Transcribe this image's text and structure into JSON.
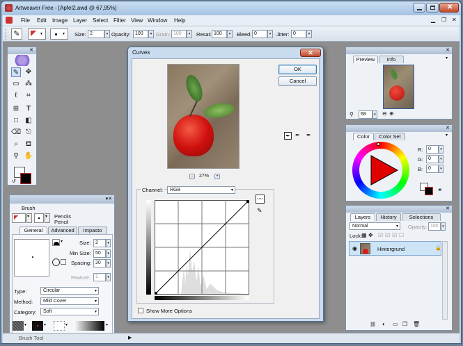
{
  "window": {
    "title": "Artweaver Free - [Apfel2.awd @ 67,95%]"
  },
  "menu": [
    "File",
    "Edit",
    "Image",
    "Layer",
    "Select",
    "Filter",
    "View",
    "Window",
    "Help"
  ],
  "toolbar": {
    "size_label": "Size:",
    "size_value": "2",
    "opacity_label": "Opacity:",
    "opacity_value": "100",
    "grain_label": "Grain:",
    "grain_value": "100",
    "resat_label": "Resat:",
    "resat_value": "100",
    "bleed_label": "Bleed:",
    "bleed_value": "0",
    "jitter_label": "Jitter:",
    "jitter_value": "0"
  },
  "brush_panel": {
    "title": "Brush",
    "category_name": "Pencils",
    "variant_name": "Pencil",
    "tabs": [
      "General",
      "Advanced",
      "Impasto"
    ],
    "size_label": "Size:",
    "size_value": "2",
    "min_size_label": "Min Size:",
    "min_size_value": "50",
    "spacing_label": "Spacing:",
    "spacing_value": "20",
    "feature_label": "Feature:",
    "feature_value": "1",
    "type_label": "Type:",
    "type_value": "Circular",
    "method_label": "Method:",
    "method_value": "Mild Cover",
    "category_label": "Category:",
    "category_value": "Soft"
  },
  "curves_dialog": {
    "title": "Curves",
    "ok_label": "OK",
    "cancel_label": "Cancel",
    "zoom_value": "27%",
    "channel_label": "Channel:",
    "channel_value": "RGB",
    "show_more_label": "Show More Options"
  },
  "preview_panel": {
    "tabs": [
      "Preview",
      "Info"
    ],
    "zoom_value": "68"
  },
  "color_panel": {
    "tabs": [
      "Color",
      "Color Set"
    ],
    "r_label": "R:",
    "r_value": "0",
    "g_label": "G:",
    "g_value": "0",
    "b_label": "B:",
    "b_value": "0"
  },
  "layers_panel": {
    "tabs": [
      "Layers",
      "History",
      "Selections"
    ],
    "blend_mode": "Normal",
    "opacity_label": "Opacity:",
    "opacity_value": "100",
    "lock_label": "Lock:",
    "layer_name": "Hintergrund"
  },
  "status": {
    "text": "Brush Tool"
  },
  "colors": {
    "accent": "#2e5d9a",
    "foreground": "#ffffff",
    "background": "#000000",
    "apple_red": "#d81b16"
  }
}
